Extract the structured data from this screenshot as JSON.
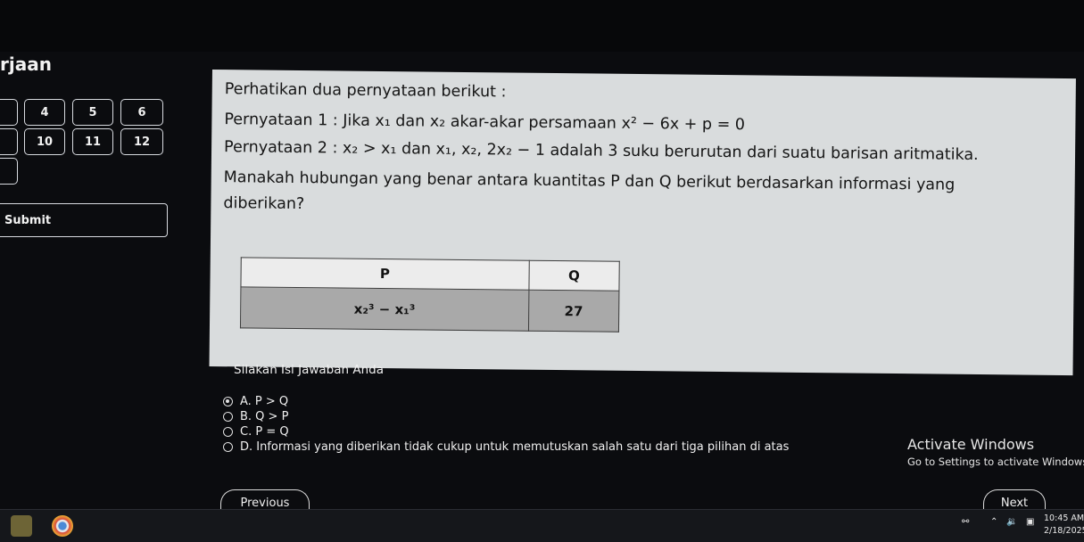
{
  "sidebar": {
    "title": "rjaan",
    "question_numbers": [
      "4",
      "5",
      "6",
      "10",
      "11",
      "12"
    ],
    "submit_label": "Submit"
  },
  "question": {
    "intro": "Perhatikan dua pernyataan berikut :",
    "statement1": "Pernyataan 1 : Jika x₁ dan x₂ akar-akar persamaan x² − 6x + p = 0",
    "statement2": "Pernyataan 2 : x₂ > x₁ dan x₁, x₂, 2x₂ − 1 adalah 3 suku berurutan dari suatu barisan aritmatika.",
    "prompt_line1": "Manakah hubungan yang benar antara kuantitas P dan Q berikut berdasarkan informasi yang",
    "prompt_line2": "diberikan?",
    "table": {
      "headers": [
        "P",
        "Q"
      ],
      "row": [
        "x₂³ − x₁³",
        "27"
      ]
    }
  },
  "answer": {
    "label": "Silakan Isi Jawaban Anda",
    "options": [
      {
        "text": "A. P > Q",
        "selected": true
      },
      {
        "text": "B. Q > P",
        "selected": false
      },
      {
        "text": "C. P = Q",
        "selected": false
      },
      {
        "text": "D. Informasi yang diberikan tidak cukup untuk memutuskan salah satu dari tiga pilihan di atas",
        "selected": false
      }
    ]
  },
  "activation": {
    "title": "Activate Windows",
    "subtitle": "Go to Settings to activate Windows"
  },
  "navigation": {
    "previous_label": "Previous",
    "next_label": "Next"
  },
  "taskbar": {
    "time": "10:45 AM",
    "date": "2/18/2025"
  }
}
